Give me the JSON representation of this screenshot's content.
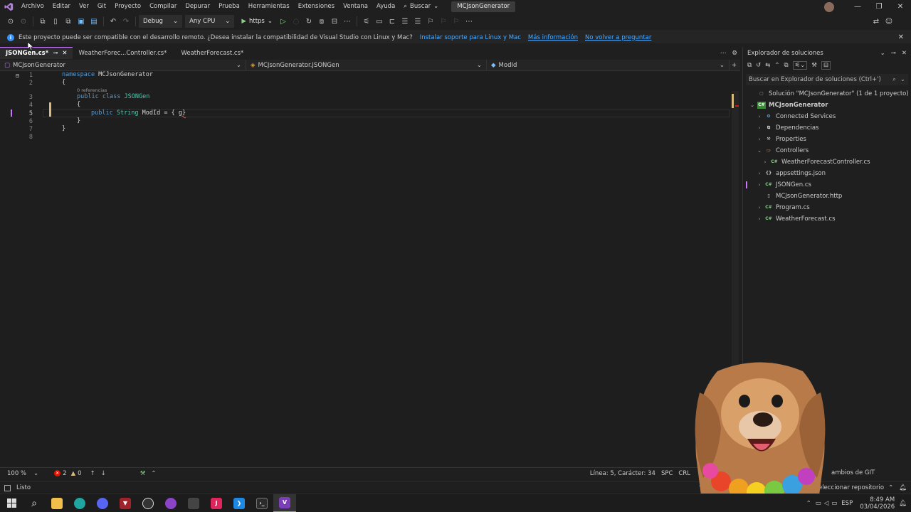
{
  "menubar": {
    "items": [
      "Archivo",
      "Editar",
      "Ver",
      "Git",
      "Proyecto",
      "Compilar",
      "Depurar",
      "Prueba",
      "Herramientas",
      "Extensiones",
      "Ventana",
      "Ayuda"
    ],
    "search_label": "Buscar",
    "solution_name": "MCJsonGenerator"
  },
  "toolbar": {
    "configuration": "Debug",
    "platform": "Any CPU",
    "run_target": "https"
  },
  "infobar": {
    "message": "Este proyecto puede ser compatible con el desarrollo remoto. ¿Desea instalar la compatibilidad de Visual Studio con Linux y Mac?",
    "link_install": "Instalar soporte para Linux y Mac",
    "link_more": "Más información",
    "link_never": "No volver a preguntar"
  },
  "tabs": [
    {
      "label": "JSONGen.cs*",
      "active": true
    },
    {
      "label": "WeatherForec...Controller.cs*",
      "active": false
    },
    {
      "label": "WeatherForecast.cs*",
      "active": false
    }
  ],
  "navbar": {
    "project": "MCJsonGenerator",
    "type": "MCJsonGenerator.JSONGen",
    "member": "ModId"
  },
  "editor": {
    "line_numbers": [
      "1",
      "2",
      "3",
      "4",
      "5",
      "6",
      "7",
      "8"
    ],
    "references_hint": "0 referencias",
    "line1_kw": "namespace",
    "line1_name": " MCJsonGenerator",
    "brace_open": "{",
    "brace_close": "}",
    "line3_kw": "public class",
    "line3_name": " JSONGen",
    "line5_kw": "public",
    "line5_type": " String",
    "line5_rest": " ModId = { ",
    "line5_err": "g}"
  },
  "solution_explorer": {
    "title": "Explorador de soluciones",
    "search_placeholder": "Buscar en Explorador de soluciones (Ctrl+')",
    "solution": "Solución \"MCJsonGenerator\" (1 de 1 proyecto)",
    "project": "MCJsonGenerator",
    "items": [
      "Connected Services",
      "Dependencias",
      "Properties",
      "Controllers",
      "WeatherForecastController.cs",
      "appsettings.json",
      "JSONGen.cs",
      "MCJsonGenerator.http",
      "Program.cs",
      "WeatherForecast.cs"
    ]
  },
  "editor_status": {
    "zoom": "100 %",
    "errors": "2",
    "warnings": "0",
    "position": "Línea: 5, Carácter: 34",
    "whitespace": "SPC",
    "eol": "CRL",
    "git_changes": "ambios de GIT"
  },
  "statusbar": {
    "ready": "Listo",
    "repo": "eleccionar repositorio"
  },
  "taskbar": {
    "time": "8:49 AM",
    "date": "03/04/2026",
    "lang": "ESP"
  },
  "colors": {
    "accent": "#ca79ff",
    "link": "#4daafc",
    "error": "#e51400",
    "warning": "#d7ba7d",
    "keyword": "#569cd6",
    "type": "#4ec9b0"
  }
}
